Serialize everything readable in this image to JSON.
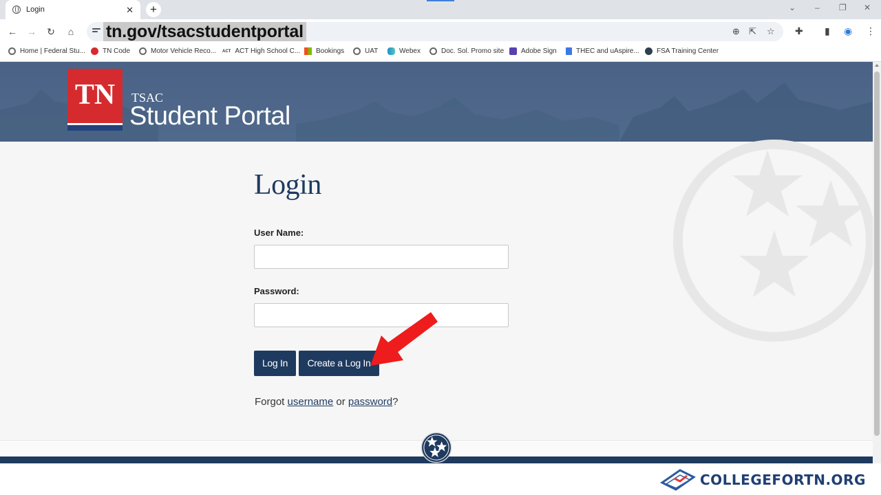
{
  "browser": {
    "tab_title": "Login",
    "tab_close": "✕",
    "new_tab": "+",
    "url": "tn.gov/tsacstudentportal",
    "bookmarks": [
      {
        "label": "Home | Federal Stu...",
        "icon": "globe-icon"
      },
      {
        "label": "TN Code",
        "icon": "tn-code-icon"
      },
      {
        "label": "Motor Vehicle Reco...",
        "icon": "globe-icon"
      },
      {
        "label": "ACT High School C...",
        "icon": "act-icon"
      },
      {
        "label": "Bookings",
        "icon": "microsoft-icon"
      },
      {
        "label": "UAT",
        "icon": "globe-icon"
      },
      {
        "label": "Webex",
        "icon": "webex-icon"
      },
      {
        "label": "Doc. Sol. Promo site",
        "icon": "globe-icon"
      },
      {
        "label": "Adobe Sign",
        "icon": "adobe-sign-icon"
      },
      {
        "label": "THEC and uAspire...",
        "icon": "doc-icon"
      },
      {
        "label": "FSA Training Center",
        "icon": "fsa-icon"
      }
    ]
  },
  "header": {
    "logo_letters": "TN",
    "org": "TSAC",
    "title": "Student Portal"
  },
  "login": {
    "heading": "Login",
    "username_label": "User Name:",
    "username_value": "",
    "password_label": "Password:",
    "password_value": "",
    "login_button": "Log In",
    "create_button": "Create a Log In",
    "forgot_prefix": "Forgot ",
    "forgot_username": "username",
    "forgot_or": " or ",
    "forgot_password": "password",
    "forgot_suffix": "?"
  },
  "watermark": {
    "text": "COLLEGEFORTN.ORG"
  },
  "colors": {
    "navy": "#1f3a5f",
    "banner": "#4f6889",
    "tn_red": "#d52b2f",
    "arrow_red": "#ee1c1c"
  }
}
